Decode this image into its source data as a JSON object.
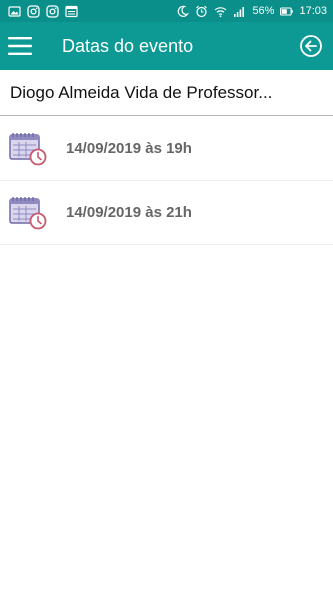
{
  "status_bar": {
    "battery_percent": "56%",
    "time": "17:03",
    "left_icons": [
      "gallery-icon",
      "instagram-icon",
      "instagram-icon",
      "news-icon"
    ],
    "right_icons": [
      "night-mode-icon",
      "alarm-icon",
      "wifi-icon",
      "signal-icon",
      "battery-icon"
    ]
  },
  "app_bar": {
    "title": "Datas do evento",
    "color": "#0d9a94",
    "menu_icon": "hamburger-menu-icon",
    "back_icon": "back-arrow-icon"
  },
  "event": {
    "title": "Diogo Almeida Vida de Professor..."
  },
  "dates": [
    {
      "label": "14/09/2019 às 19h",
      "icon": "calendar-clock-icon"
    },
    {
      "label": "14/09/2019 às 21h",
      "icon": "calendar-clock-icon"
    }
  ]
}
